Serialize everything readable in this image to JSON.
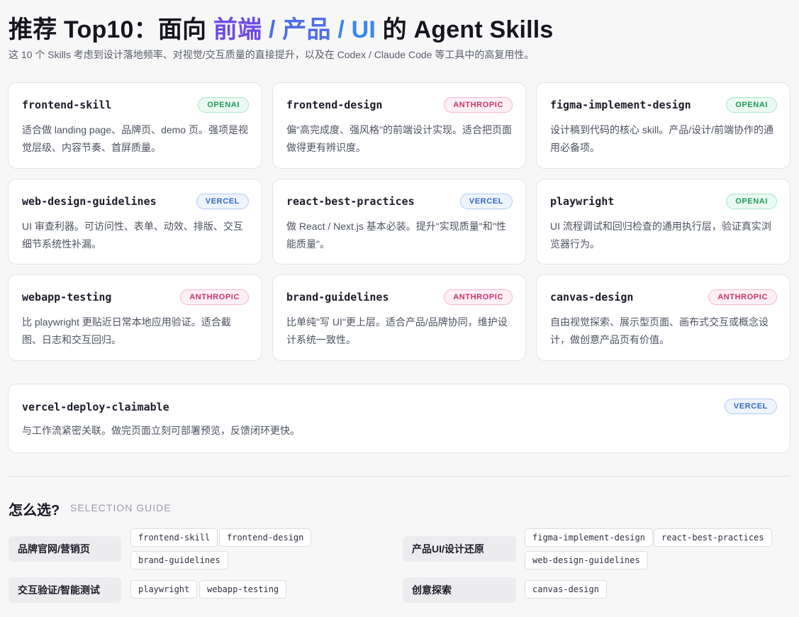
{
  "header": {
    "title_pre": "推荐 Top10：面向 ",
    "title_hl1": "前端",
    "title_sep1": " / ",
    "title_hl2": "产品",
    "title_sep2": " / ",
    "title_hl3": "UI",
    "title_post": " 的 Agent Skills",
    "subtitle": "这 10 个 Skills 考虑到设计落地频率、对视觉/交互质量的直接提升，以及在 Codex / Claude Code 等工具中的高复用性。"
  },
  "cards": [
    {
      "name": "frontend-skill",
      "badge": "OPENAI",
      "desc": "适合做 landing page、品牌页、demo 页。强项是视觉层级、内容节奏、首屏质量。"
    },
    {
      "name": "frontend-design",
      "badge": "ANTHROPIC",
      "desc": "偏\"高完成度、强风格\"的前端设计实现。适合把页面做得更有辨识度。"
    },
    {
      "name": "figma-implement-design",
      "badge": "OPENAI",
      "desc": "设计稿到代码的核心 skill。产品/设计/前端协作的通用必备项。"
    },
    {
      "name": "web-design-guidelines",
      "badge": "VERCEL",
      "desc": "UI 审查利器。可访问性、表单、动效、排版、交互细节系统性补漏。"
    },
    {
      "name": "react-best-practices",
      "badge": "VERCEL",
      "desc": "做 React / Next.js 基本必装。提升\"实现质量\"和\"性能质量\"。"
    },
    {
      "name": "playwright",
      "badge": "OPENAI",
      "desc": "UI 流程调试和回归检查的通用执行层，验证真实浏览器行为。"
    },
    {
      "name": "webapp-testing",
      "badge": "ANTHROPIC",
      "desc": "比 playwright 更贴近日常本地应用验证。适合截图、日志和交互回归。"
    },
    {
      "name": "brand-guidelines",
      "badge": "ANTHROPIC",
      "desc": "比单纯\"写 UI\"更上层。适合产品/品牌协同，维护设计系统一致性。"
    },
    {
      "name": "canvas-design",
      "badge": "ANTHROPIC",
      "desc": "自由视觉探索、展示型页面、画布式交互或概念设计，做创意产品页有价值。"
    },
    {
      "name": "vercel-deploy-claimable",
      "badge": "VERCEL",
      "desc": "与工作流紧密关联。做完页面立刻可部署预览，反馈闭环更快。"
    }
  ],
  "guide": {
    "title": "怎么选?",
    "subtitle": "SELECTION GUIDE",
    "categories": [
      {
        "label": "品牌官网/营销页",
        "skills": [
          "frontend-skill",
          "frontend-design",
          "brand-guidelines"
        ]
      },
      {
        "label": "产品UI/设计还原",
        "skills": [
          "figma-implement-design",
          "react-best-practices",
          "web-design-guidelines"
        ]
      },
      {
        "label": "交互验证/智能测试",
        "skills": [
          "playwright",
          "webapp-testing"
        ]
      },
      {
        "label": "创意探索",
        "skills": [
          "canvas-design"
        ]
      }
    ]
  },
  "colors": {
    "title_highlight_1": "#6d4ae6",
    "title_highlight_2": "#4f6fe8",
    "title_highlight_3": "#3a86f0",
    "badge_openai": "#1f9a5c",
    "badge_anthropic": "#cf2f6e",
    "badge_vercel": "#2f66c8"
  }
}
